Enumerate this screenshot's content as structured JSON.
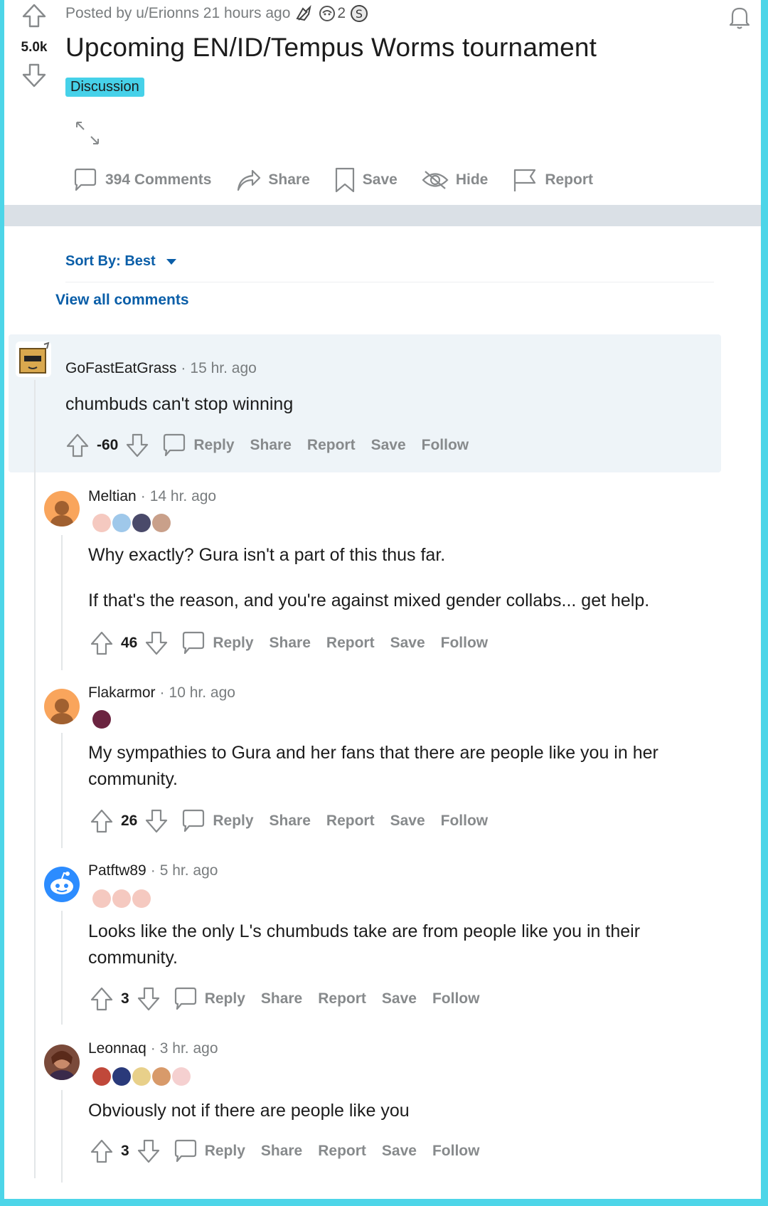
{
  "post": {
    "posted_by": "Posted by u/Erionns 21 hours ago",
    "award_count": "2",
    "vote_count": "5.0k",
    "title": "Upcoming EN/ID/Tempus Worms tournament",
    "flair": "Discussion",
    "actions": {
      "comments": "394 Comments",
      "share": "Share",
      "save": "Save",
      "hide": "Hide",
      "report": "Report"
    }
  },
  "sort": {
    "label": "Sort By: Best"
  },
  "view_all": "View all comments",
  "comments": [
    {
      "user": "GoFastEatGrass",
      "time": "15 hr. ago",
      "body": [
        "chumbuds can't stop winning"
      ],
      "score": "-60"
    },
    {
      "user": "Meltian",
      "time": "14 hr. ago",
      "body": [
        "Why exactly? Gura isn't a part of this thus far.",
        "If that's the reason, and you're against mixed gender collabs... get help."
      ],
      "score": "46"
    },
    {
      "user": "Flakarmor",
      "time": "10 hr. ago",
      "body": [
        "My sympathies to Gura and her fans that there are people like you in her community."
      ],
      "score": "26"
    },
    {
      "user": "Patftw89",
      "time": "5 hr. ago",
      "body": [
        "Looks like the only L's chumbuds take are from people like you in their community."
      ],
      "score": "3"
    },
    {
      "user": "Leonnaq",
      "time": "3 hr. ago",
      "body": [
        "Obviously not if there are people like you"
      ],
      "score": "3"
    }
  ],
  "comment_actions": {
    "reply": "Reply",
    "share": "Share",
    "report": "Report",
    "save": "Save",
    "follow": "Follow"
  },
  "colors": {
    "frame": "#4dd5e8",
    "flair_bg": "#46d1e9",
    "link_blue": "#0a5ea8",
    "action_gray": "#878a8c",
    "highlight": "#eef4f8"
  }
}
